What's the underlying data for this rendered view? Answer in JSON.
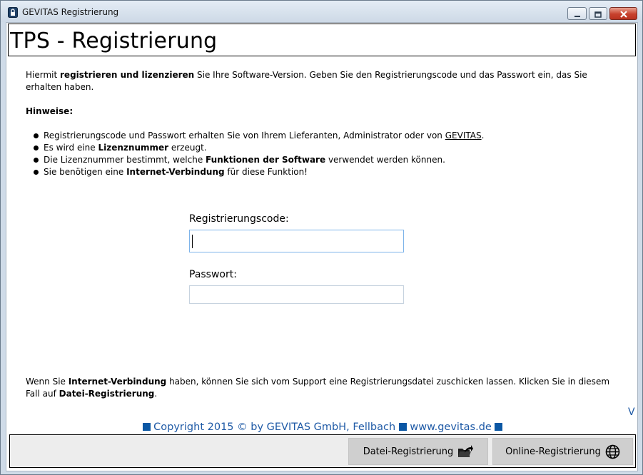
{
  "window": {
    "title": "GEVITAS Registrierung",
    "icon": "lock-icon"
  },
  "header": {
    "title": "TPS - Registrierung"
  },
  "intro": {
    "prefix": "Hiermit ",
    "bold": "registrieren und lizenzieren",
    "suffix": " Sie Ihre Software-Version. Geben Sie den Registrierungscode und das Passwort ein, das Sie erhalten haben."
  },
  "hinweise": {
    "heading": "Hinweise:",
    "items": [
      {
        "t1": "Registrierungscode und Passwort erhalten Sie von Ihrem Lieferanten, Administrator oder von ",
        "link": "GEVITAS",
        "t2": "."
      },
      {
        "t1": "Es wird eine ",
        "bold": "Lizenznummer",
        "t2": " erzeugt."
      },
      {
        "t1": "Die Lizenznummer bestimmt, welche ",
        "bold": "Funktionen der Software",
        "t2": " verwendet werden können."
      },
      {
        "t1": "Sie benötigen eine ",
        "bold": "Internet-Verbindung",
        "t2": " für diese Funktion!"
      }
    ]
  },
  "form": {
    "code_label": "Registrierungscode:",
    "code_value": "",
    "password_label": "Passwort:",
    "password_value": ""
  },
  "bottom_info": {
    "t1": "Wenn Sie ",
    "b1": "Internet-Verbindung",
    "t2": " haben, können Sie sich vom Support eine Registrierungsdatei zuschicken lassen. Klicken Sie in diesem Fall auf ",
    "b2": "Datei-Registrierung",
    "t3": "."
  },
  "version_marker": "V",
  "copyright": {
    "text": "Copyright 2015 © by GEVITAS GmbH, Fellbach",
    "url": "www.gevitas.de"
  },
  "buttons": {
    "datei": "Datei-Registrierung",
    "datei_icon": "folder-share-icon",
    "online": "Online-Registrierung",
    "online_icon": "globe-icon"
  },
  "colors": {
    "accent": "#1f5aa6",
    "square": "#0b57a4",
    "button_bg": "#cfcfcf"
  }
}
